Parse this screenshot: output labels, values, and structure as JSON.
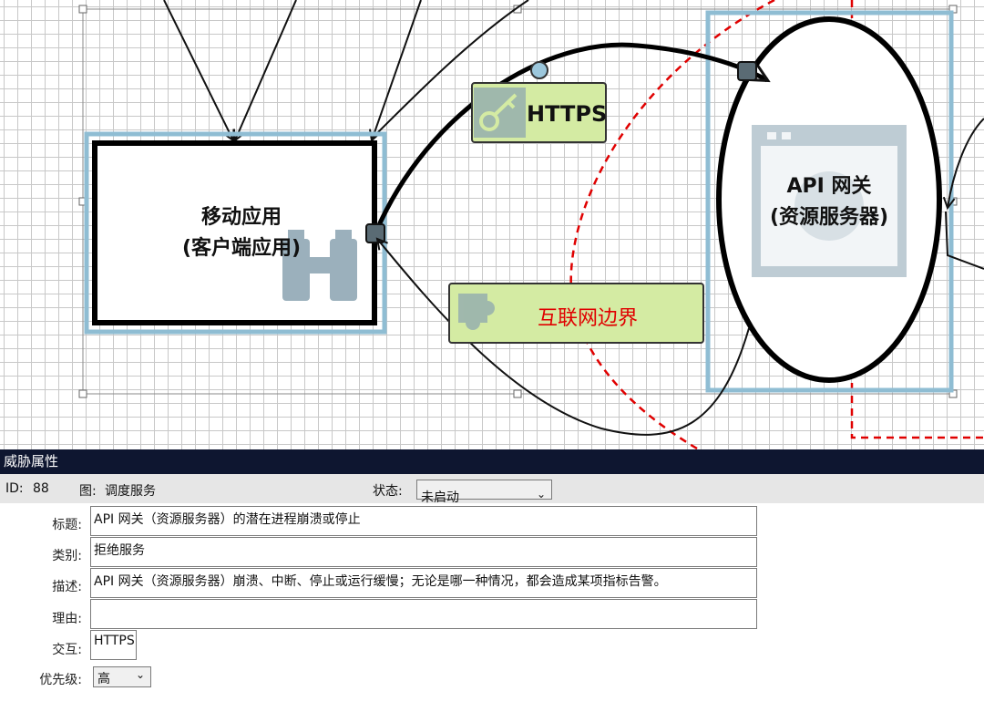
{
  "diagram": {
    "mobile_app": {
      "line1": "移动应用",
      "line2": "(客户端应用)"
    },
    "api_gateway": {
      "line1": "API 网关",
      "line2": "(资源服务器)"
    },
    "flow_label": "HTTPS",
    "boundary_label": "互联网边界",
    "colors": {
      "selection": "#8fbdd3",
      "flow_box": "#d4eba3",
      "boundary": "#e00000",
      "icon": "#8aa3b1"
    }
  },
  "panel": {
    "title": "威胁属性",
    "id_label": "ID:",
    "id_value": "88",
    "diagram_label": "图:",
    "diagram_value": "调度服务",
    "state_label": "状态:",
    "state_value": "未启动",
    "fields": {
      "title_label": "标题:",
      "title_value": "API 网关（资源服务器）的潜在进程崩溃或停止",
      "category_label": "类别:",
      "category_value": "拒绝服务",
      "description_label": "描述:",
      "description_value": "API 网关（资源服务器）崩溃、中断、停止或运行缓慢；无论是哪一种情况，都会造成某项指标告警。",
      "reason_label": "理由:",
      "reason_value": "",
      "interaction_label": "交互:",
      "interaction_value": "HTTPS",
      "priority_label": "优先级:",
      "priority_value": "高"
    }
  }
}
